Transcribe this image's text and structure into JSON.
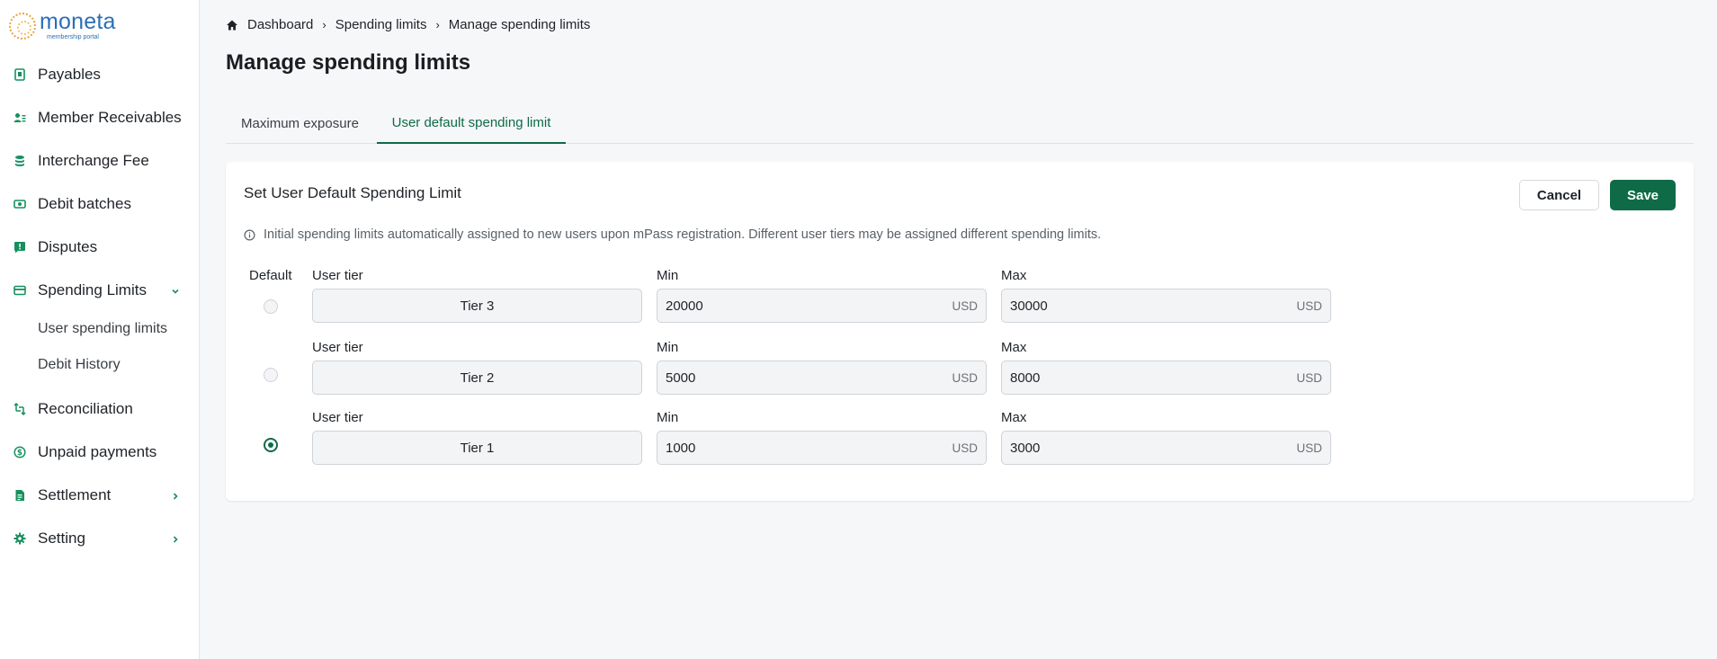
{
  "logo": {
    "name": "moneta",
    "subtitle": "membership portal"
  },
  "sidebar": {
    "items": [
      {
        "label": "Payables",
        "icon": "payables-icon"
      },
      {
        "label": "Member Receivables",
        "icon": "member-receivables-icon"
      },
      {
        "label": "Interchange Fee",
        "icon": "database-icon"
      },
      {
        "label": "Debit batches",
        "icon": "cash-icon"
      },
      {
        "label": "Disputes",
        "icon": "alert-message-icon"
      },
      {
        "label": "Spending Limits",
        "icon": "card-icon",
        "expanded": true
      },
      {
        "label": "Reconciliation",
        "icon": "reconcile-icon"
      },
      {
        "label": "Unpaid payments",
        "icon": "dollar-circle-icon"
      },
      {
        "label": "Settlement",
        "icon": "document-icon"
      },
      {
        "label": "Setting",
        "icon": "gear-icon"
      }
    ],
    "subitems": [
      {
        "label": "User spending limits"
      },
      {
        "label": "Debit History"
      }
    ]
  },
  "breadcrumb": {
    "home": "Dashboard",
    "level1": "Spending limits",
    "level2": "Manage spending limits"
  },
  "page": {
    "title": "Manage spending limits"
  },
  "tabs": [
    {
      "label": "Maximum exposure",
      "active": false
    },
    {
      "label": "User default spending limit",
      "active": true
    }
  ],
  "card": {
    "title": "Set User Default Spending Limit",
    "cancel_label": "Cancel",
    "save_label": "Save",
    "info": "Initial spending limits automatically assigned to new users upon mPass registration. Different user tiers may be assigned different spending limits.",
    "default_header": "Default",
    "rows": [
      {
        "tier_label": "User tier",
        "tier": "Tier 3",
        "min_label": "Min",
        "min": "20000",
        "min_unit": "USD",
        "max_label": "Max",
        "max": "30000",
        "max_unit": "USD",
        "default": false
      },
      {
        "tier_label": "User tier",
        "tier": "Tier 2",
        "min_label": "Min",
        "min": "5000",
        "min_unit": "USD",
        "max_label": "Max",
        "max": "8000",
        "max_unit": "USD",
        "default": false
      },
      {
        "tier_label": "User tier",
        "tier": "Tier 1",
        "min_label": "Min",
        "min": "1000",
        "min_unit": "USD",
        "max_label": "Max",
        "max": "3000",
        "max_unit": "USD",
        "default": true
      }
    ]
  },
  "colors": {
    "accent": "#0f6b47",
    "icon": "#16905f",
    "brand": "#2b6fb6"
  }
}
